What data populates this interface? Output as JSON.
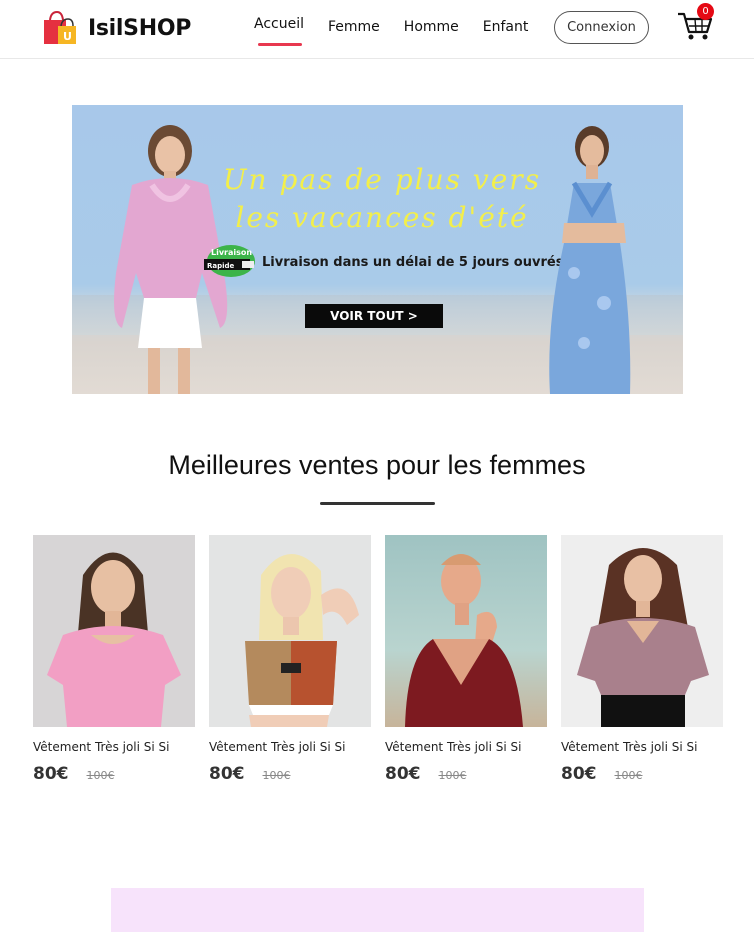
{
  "brand": {
    "name": "IsilSHOP",
    "logo_letter": "U"
  },
  "nav": {
    "items": [
      {
        "label": "Accueil",
        "active": true
      },
      {
        "label": "Femme",
        "active": false
      },
      {
        "label": "Homme",
        "active": false
      },
      {
        "label": "Enfant",
        "active": false
      }
    ]
  },
  "header": {
    "login_label": "Connexion",
    "cart_count": "0"
  },
  "banner": {
    "headline_line1": "Un pas de plus vers",
    "headline_line2": "les vacances d'été",
    "badge_line1": "Livraison",
    "badge_line2": "Rapide",
    "delivery_text": "Livraison dans un délai de 5 jours ouvrés",
    "cta_label": "VOIR TOUT >"
  },
  "section": {
    "title": "Meilleures ventes pour les femmes"
  },
  "products": [
    {
      "name": "Vêtement Très joli Si Si",
      "price": "80€",
      "old_price": "100€"
    },
    {
      "name": "Vêtement Très joli Si Si",
      "price": "80€",
      "old_price": "100€"
    },
    {
      "name": "Vêtement Très joli Si Si",
      "price": "80€",
      "old_price": "100€"
    },
    {
      "name": "Vêtement Très joli Si Si",
      "price": "80€",
      "old_price": "100€"
    }
  ],
  "colors": {
    "accent": "#e8384f",
    "badge": "#e50914",
    "banner_sky": "#a8c8ea",
    "headline": "#f3ef4a",
    "pink_block": "#f7e3fb"
  },
  "icons": [
    "shopping-bag-logo-icon",
    "cart-icon"
  ]
}
